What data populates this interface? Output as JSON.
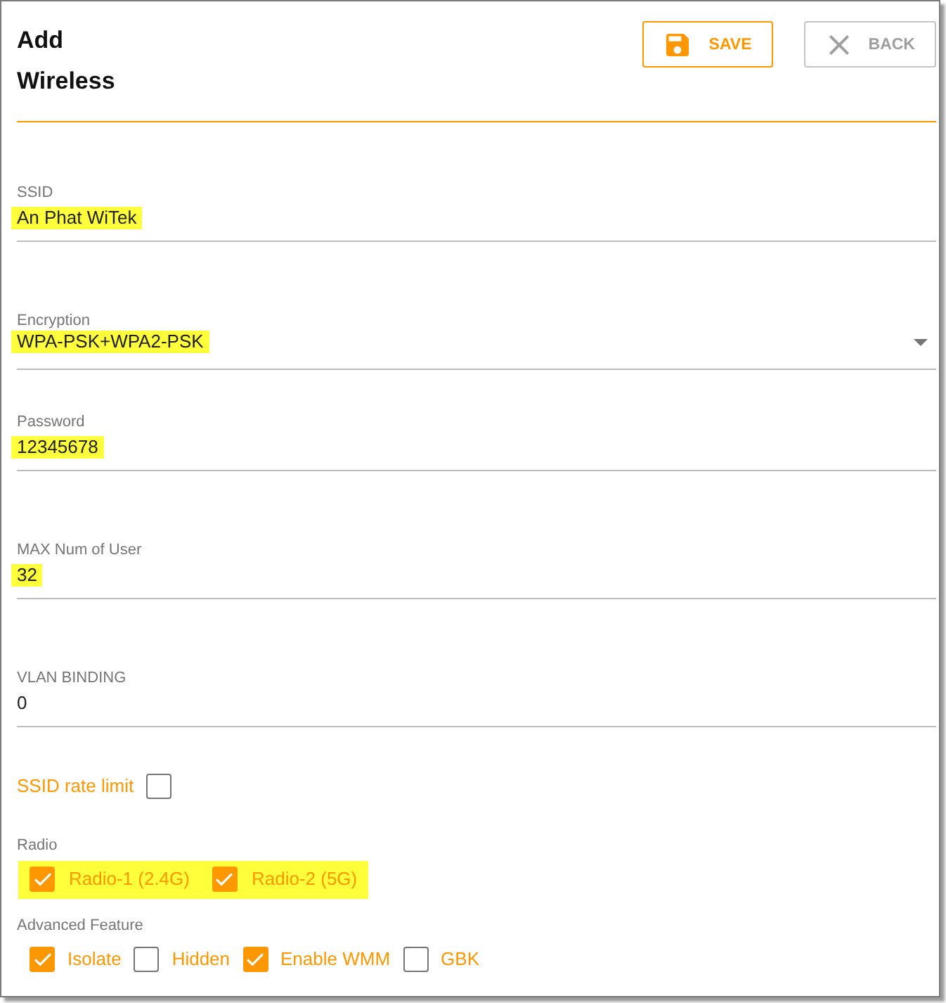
{
  "header": {
    "title": "Add Wireless",
    "buttons": [
      {
        "kind": "save",
        "label": "SAVE"
      },
      {
        "kind": "back",
        "label": "BACK"
      }
    ]
  },
  "fields": [
    {
      "kind": "text",
      "label": "SSID",
      "value": "An Phat WiTek",
      "highlighted": true
    },
    {
      "kind": "select",
      "label": "Encryption",
      "value": "WPA-PSK+WPA2-PSK",
      "highlighted": true
    },
    {
      "kind": "text",
      "label": "Password",
      "value": "12345678",
      "highlighted": true
    },
    {
      "kind": "text",
      "label": "MAX Num of User",
      "value": "32",
      "highlighted": true
    },
    {
      "kind": "text",
      "label": "VLAN BINDING",
      "value": "0",
      "highlighted": false
    }
  ],
  "rate_limit": {
    "label": "SSID rate limit",
    "checked": false
  },
  "radio": {
    "label": "Radio",
    "highlighted": true,
    "options": [
      {
        "label": "Radio-1 (2.4G)",
        "checked": true
      },
      {
        "label": "Radio-2 (5G)",
        "checked": true
      }
    ]
  },
  "advanced_feature": {
    "label": "Advanced Feature",
    "options": [
      {
        "label": "Isolate",
        "checked": true
      },
      {
        "label": "Hidden",
        "checked": false
      },
      {
        "label": "Enable WMM",
        "checked": true
      },
      {
        "label": "GBK",
        "checked": false
      }
    ]
  }
}
